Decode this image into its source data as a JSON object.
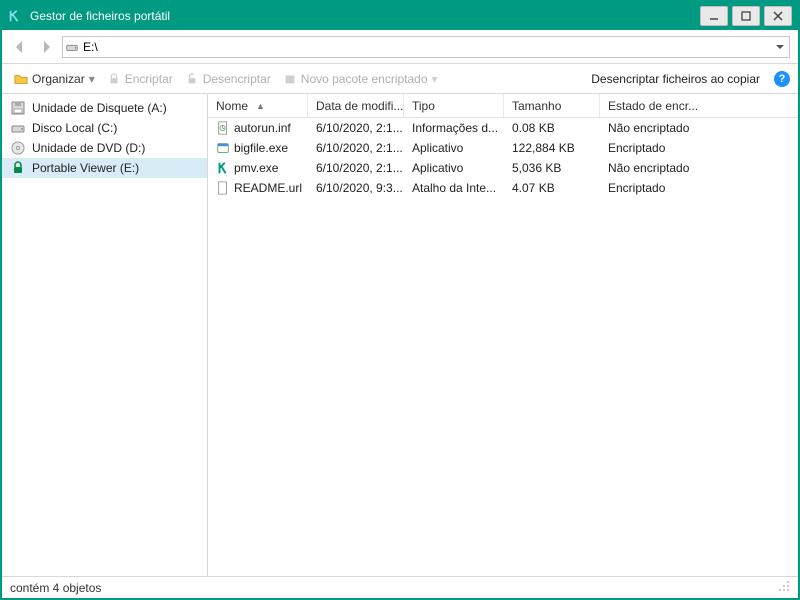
{
  "window": {
    "title": "Gestor de ficheiros portátil"
  },
  "address": {
    "path": "E:\\"
  },
  "toolbar": {
    "organize": "Organizar",
    "encrypt": "Encriptar",
    "decrypt": "Desencriptar",
    "newpkg": "Novo pacote encriptado",
    "copy_decrypt": "Desencriptar ficheiros ao copiar"
  },
  "sidebar": {
    "items": [
      {
        "label": "Unidade de Disquete (A:)",
        "icon": "floppy"
      },
      {
        "label": "Disco Local (C:)",
        "icon": "hdd"
      },
      {
        "label": "Unidade de DVD (D:)",
        "icon": "dvd"
      },
      {
        "label": "Portable Viewer (E:)",
        "icon": "lock",
        "selected": true
      }
    ]
  },
  "columns": {
    "name": "Nome",
    "date": "Data de modifi...",
    "type": "Tipo",
    "size": "Tamanho",
    "enc": "Estado de encr..."
  },
  "files": [
    {
      "icon": "inf",
      "name": "autorun.inf",
      "date": "6/10/2020, 2:1...",
      "type": "Informações d...",
      "size": "0.08 KB",
      "enc": "Não encriptado"
    },
    {
      "icon": "exe",
      "name": "bigfile.exe",
      "date": "6/10/2020, 2:1...",
      "type": "Aplicativo",
      "size": "122,884 KB",
      "enc": "Encriptado"
    },
    {
      "icon": "k",
      "name": "pmv.exe",
      "date": "6/10/2020, 2:1...",
      "type": "Aplicativo",
      "size": "5,036 KB",
      "enc": "Não encriptado"
    },
    {
      "icon": "url",
      "name": "README.url",
      "date": "6/10/2020, 9:3...",
      "type": "Atalho da Inte...",
      "size": "4.07 KB",
      "enc": "Encriptado"
    }
  ],
  "status": {
    "text": "contém 4 objetos"
  }
}
